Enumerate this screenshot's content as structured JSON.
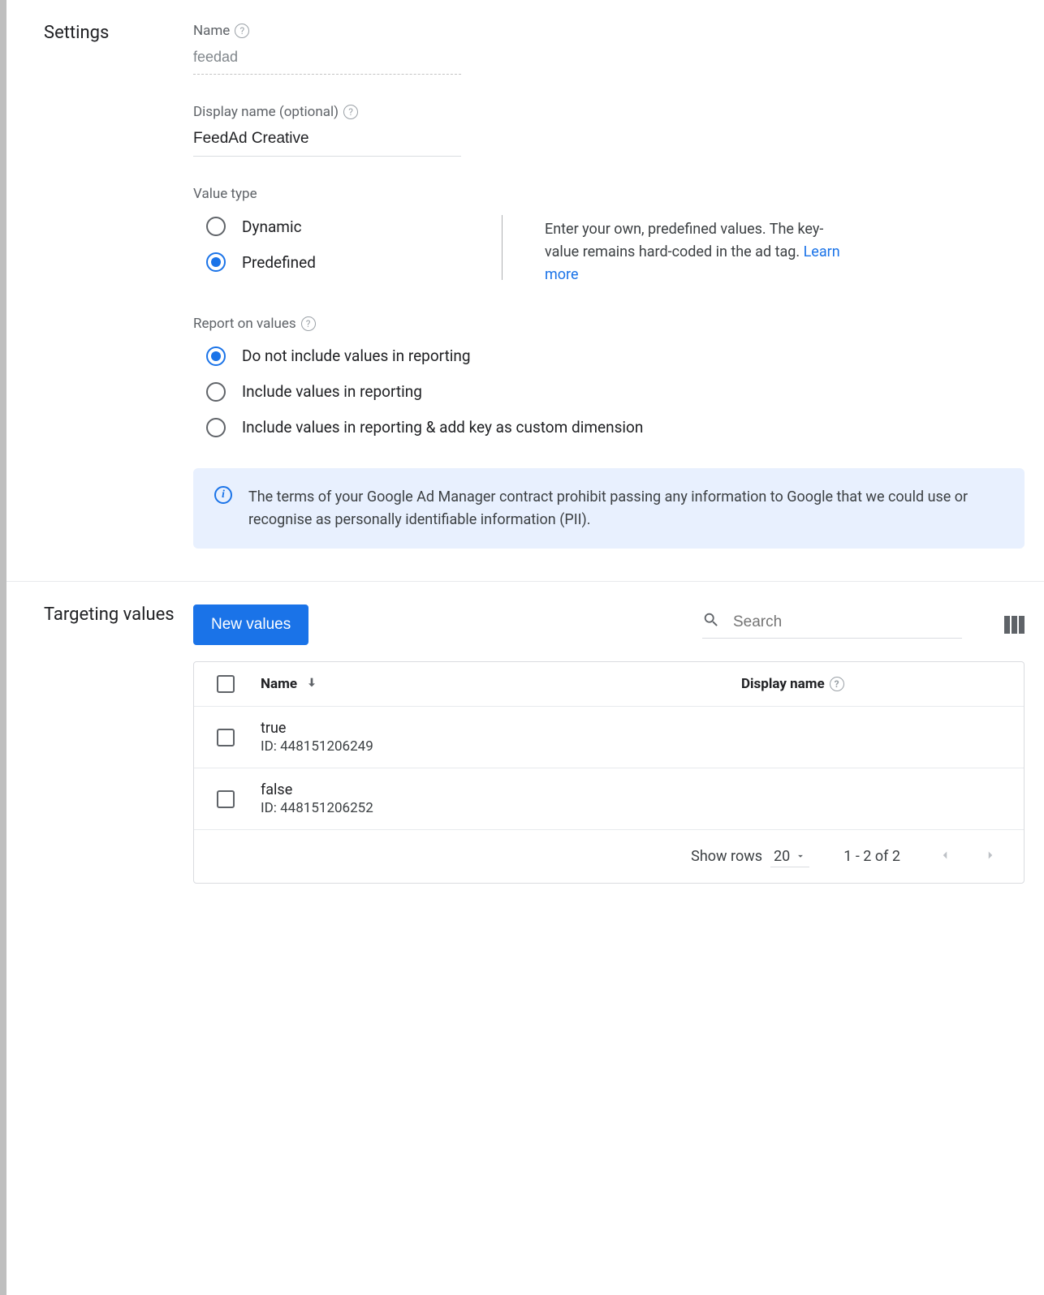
{
  "settings": {
    "section_label": "Settings",
    "name_label": "Name",
    "name_value": "feedad",
    "display_name_label": "Display name (optional)",
    "display_name_value": "FeedAd Creative",
    "value_type_label": "Value type",
    "value_type_options": {
      "dynamic": "Dynamic",
      "predefined": "Predefined"
    },
    "value_type_help": "Enter your own, predefined values. The key-value remains hard-coded in the ad tag. ",
    "value_type_help_link": "Learn more",
    "report_label": "Report on values",
    "report_options": {
      "none": "Do not include values in reporting",
      "include": "Include values in reporting",
      "include_dim": "Include values in reporting & add key as custom dimension"
    },
    "info_banner": "The terms of your Google Ad Manager contract prohibit passing any information to Google that we could use or recognise as personally identifiable information (PII)."
  },
  "targeting": {
    "section_label": "Targeting values",
    "new_button": "New values",
    "search_placeholder": "Search",
    "columns": {
      "name": "Name",
      "display": "Display name"
    },
    "rows": [
      {
        "name": "true",
        "id": "ID: 448151206249",
        "display": ""
      },
      {
        "name": "false",
        "id": "ID: 448151206252",
        "display": ""
      }
    ],
    "footer": {
      "show_rows_label": "Show rows",
      "page_size": "20",
      "range": "1 - 2 of 2"
    }
  }
}
